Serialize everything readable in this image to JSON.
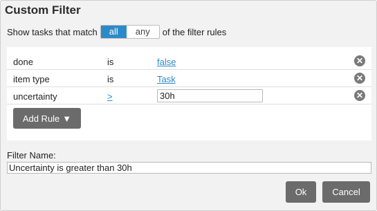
{
  "dialog": {
    "title": "Custom Filter"
  },
  "match": {
    "prefix": "Show tasks that match",
    "options": [
      "all",
      "any"
    ],
    "selected": "all",
    "suffix": "of the filter rules"
  },
  "rules": [
    {
      "field": "done",
      "operator": "is",
      "value": "false"
    },
    {
      "field": "item type",
      "operator": "is",
      "value": "Task"
    },
    {
      "field": "uncertainty",
      "operator": ">",
      "value": "30h"
    }
  ],
  "icons": {
    "remove": "close-circle-icon",
    "dropdown": "caret-down-icon"
  },
  "add_rule": {
    "label": "Add Rule",
    "caret": "▼"
  },
  "filter_name": {
    "label": "Filter Name:",
    "value": "Uncertainty is greater than 30h"
  },
  "buttons": {
    "ok": "Ok",
    "cancel": "Cancel"
  },
  "colors": {
    "accent": "#2d8ac7",
    "button": "#6b6b6b",
    "panel": "#f2f2f2"
  }
}
